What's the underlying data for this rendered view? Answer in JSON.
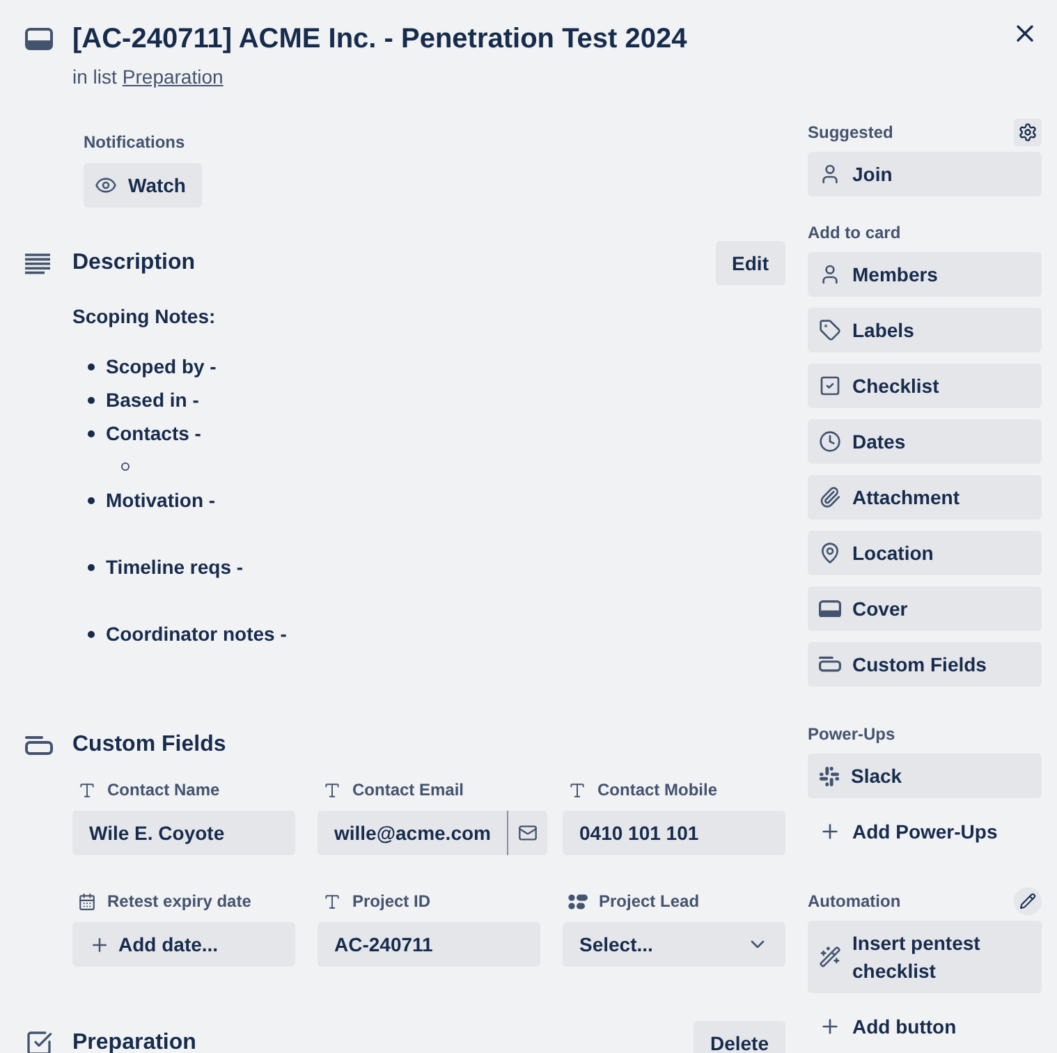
{
  "card": {
    "title": "[AC-240711] ACME Inc. - Penetration Test 2024",
    "list_prefix": "in list",
    "list_name": "Preparation"
  },
  "notifications": {
    "label": "Notifications",
    "button": "Watch"
  },
  "description": {
    "heading": "Description",
    "edit_button": "Edit",
    "title": "Scoping Notes:",
    "items": [
      {
        "text": "Scoped by -"
      },
      {
        "text": "Based in -"
      },
      {
        "text": "Contacts -",
        "children": [
          {
            "kind": "empty"
          }
        ]
      },
      {
        "text": "Motivation -"
      },
      {
        "text": "Timeline reqs -"
      },
      {
        "text": "Coordinator notes -"
      }
    ]
  },
  "custom_fields": {
    "heading": "Custom Fields",
    "fields": [
      {
        "kind": "text",
        "label": "Contact Name",
        "value": "Wile E. Coyote"
      },
      {
        "kind": "email",
        "label": "Contact Email",
        "value": "wille@acme.com"
      },
      {
        "kind": "text",
        "label": "Contact Mobile",
        "value": "0410 101 101"
      },
      {
        "kind": "date",
        "label": "Retest expiry date",
        "button": "Add date..."
      },
      {
        "kind": "text",
        "label": "Project ID",
        "value": "AC-240711"
      },
      {
        "kind": "dropdown",
        "label": "Project Lead",
        "placeholder": "Select..."
      }
    ]
  },
  "checklist": {
    "heading": "Preparation",
    "delete_button": "Delete"
  },
  "sidebar": {
    "suggested": {
      "heading": "Suggested",
      "buttons": [
        "Join"
      ]
    },
    "add_to_card": {
      "heading": "Add to card",
      "buttons": [
        "Members",
        "Labels",
        "Checklist",
        "Dates",
        "Attachment",
        "Location",
        "Cover",
        "Custom Fields"
      ]
    },
    "power_ups": {
      "heading": "Power-Ups",
      "buttons": [
        "Slack"
      ],
      "add_link": "Add Power-Ups"
    },
    "automation": {
      "heading": "Automation",
      "buttons": [
        "Insert pentest checklist"
      ],
      "add_link": "Add button"
    }
  }
}
